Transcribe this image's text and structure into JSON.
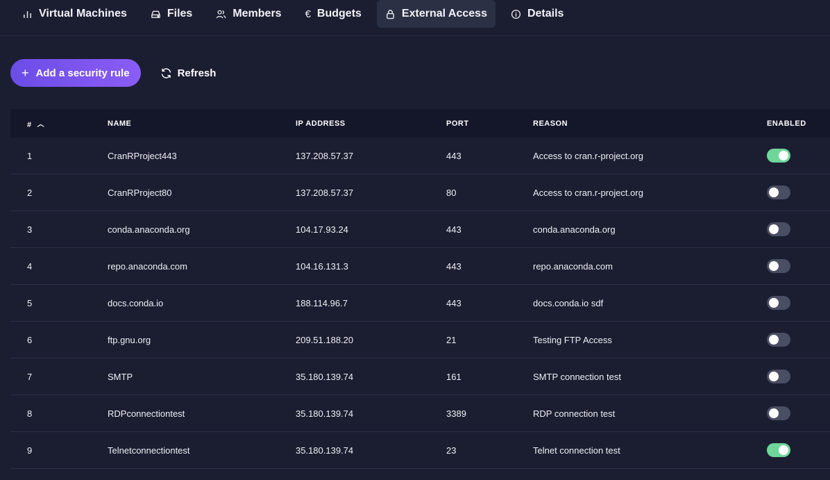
{
  "tabs": [
    {
      "label": "Virtual Machines",
      "icon": "bar-chart-icon",
      "active": false
    },
    {
      "label": "Files",
      "icon": "drive-icon",
      "active": false
    },
    {
      "label": "Members",
      "icon": "users-icon",
      "active": false
    },
    {
      "label": "Budgets",
      "icon": "euro-icon",
      "active": false
    },
    {
      "label": "External Access",
      "icon": "lock-icon",
      "active": true
    },
    {
      "label": "Details",
      "icon": "info-icon",
      "active": false
    }
  ],
  "toolbar": {
    "add_label": "Add a security rule",
    "refresh_label": "Refresh"
  },
  "table": {
    "headers": {
      "num": "#",
      "name": "NAME",
      "ip": "IP ADDRESS",
      "port": "PORT",
      "reason": "REASON",
      "enabled": "ENABLED"
    },
    "rows": [
      {
        "num": "1",
        "name": "CranRProject443",
        "ip": "137.208.57.37",
        "port": "443",
        "reason": "Access to cran.r-project.org",
        "enabled": true
      },
      {
        "num": "2",
        "name": "CranRProject80",
        "ip": "137.208.57.37",
        "port": "80",
        "reason": "Access to cran.r-project.org",
        "enabled": false
      },
      {
        "num": "3",
        "name": "conda.anaconda.org",
        "ip": "104.17.93.24",
        "port": "443",
        "reason": "conda.anaconda.org",
        "enabled": false
      },
      {
        "num": "4",
        "name": "repo.anaconda.com",
        "ip": "104.16.131.3",
        "port": "443",
        "reason": "repo.anaconda.com",
        "enabled": false
      },
      {
        "num": "5",
        "name": "docs.conda.io",
        "ip": "188.114.96.7",
        "port": "443",
        "reason": "docs.conda.io sdf",
        "enabled": false
      },
      {
        "num": "6",
        "name": "ftp.gnu.org",
        "ip": "209.51.188.20",
        "port": "21",
        "reason": "Testing FTP Access",
        "enabled": false
      },
      {
        "num": "7",
        "name": "SMTP",
        "ip": "35.180.139.74",
        "port": "161",
        "reason": "SMTP connection test",
        "enabled": false
      },
      {
        "num": "8",
        "name": "RDPconnectiontest",
        "ip": "35.180.139.74",
        "port": "3389",
        "reason": "RDP connection test",
        "enabled": false
      },
      {
        "num": "9",
        "name": "Telnetconnectiontest",
        "ip": "35.180.139.74",
        "port": "23",
        "reason": "Telnet connection test",
        "enabled": true
      }
    ]
  },
  "colors": {
    "background": "#1b1e31",
    "header_bg": "#141729",
    "accent": "#7c55ee",
    "toggle_on": "#6fd69a",
    "toggle_off": "#4a4e63"
  }
}
